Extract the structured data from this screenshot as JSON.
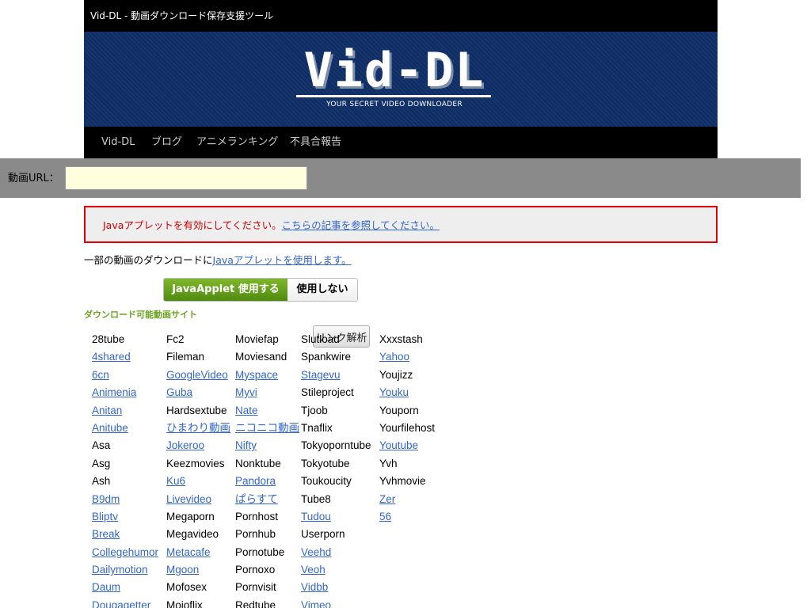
{
  "header": {
    "site_title": "Vid-DL - 動画ダウンロード保存支援ツール",
    "logo_text": "Vid-DL",
    "tagline": "YOUR SECRET VIDEO DOWNLOADER"
  },
  "nav": {
    "items": [
      {
        "label": "Vid-DL"
      },
      {
        "label": "ブログ"
      },
      {
        "label": "アニメランキング"
      },
      {
        "label": "不具合報告"
      }
    ]
  },
  "url_bar": {
    "label": "動画URL：",
    "value": "",
    "button_label": "リンク解析"
  },
  "warning": {
    "text": "Javaアプレットを有効にしてください。",
    "link_text": "こちらの記事を参照してください。"
  },
  "note": {
    "text": "一部の動画のダウンロードに",
    "link_text": "Javaアプレットを使用します。"
  },
  "toggle": {
    "on_label": "JavaApplet 使用する",
    "off_label": "使用しない"
  },
  "sites_heading": "ダウンロード可能動画サイト",
  "sites_columns": [
    [
      {
        "name": "28tube",
        "link": false
      },
      {
        "name": "4shared",
        "link": true
      },
      {
        "name": "6cn",
        "link": true
      },
      {
        "name": "Animenia",
        "link": true
      },
      {
        "name": "Anitan",
        "link": true
      },
      {
        "name": "Anitube",
        "link": true
      },
      {
        "name": "Asa",
        "link": false
      },
      {
        "name": "Asg",
        "link": false
      },
      {
        "name": "Ash",
        "link": false
      },
      {
        "name": "B9dm",
        "link": true
      },
      {
        "name": "Bliptv",
        "link": true
      },
      {
        "name": "Break",
        "link": true
      },
      {
        "name": "Collegehumor",
        "link": true
      },
      {
        "name": "Dailymotion",
        "link": true
      },
      {
        "name": "Daum",
        "link": true
      },
      {
        "name": "Dougagetter",
        "link": true
      }
    ],
    [
      {
        "name": "Fc2",
        "link": false
      },
      {
        "name": "Fileman",
        "link": false
      },
      {
        "name": "GoogleVideo",
        "link": true
      },
      {
        "name": "Guba",
        "link": true
      },
      {
        "name": "Hardsextube",
        "link": false
      },
      {
        "name": "ひまわり動画",
        "link": true
      },
      {
        "name": "Jokeroo",
        "link": true
      },
      {
        "name": "Keezmovies",
        "link": false
      },
      {
        "name": "Ku6",
        "link": true
      },
      {
        "name": "Livevideo",
        "link": true
      },
      {
        "name": "Megaporn",
        "link": false
      },
      {
        "name": "Megavideo",
        "link": false
      },
      {
        "name": "Metacafe",
        "link": true
      },
      {
        "name": "Mgoon",
        "link": true
      },
      {
        "name": "Mofosex",
        "link": false
      },
      {
        "name": "Mojoflix",
        "link": false
      }
    ],
    [
      {
        "name": "Moviefap",
        "link": false
      },
      {
        "name": "Moviesand",
        "link": false
      },
      {
        "name": "Myspace",
        "link": true
      },
      {
        "name": "Myvi",
        "link": true
      },
      {
        "name": "Nate",
        "link": true
      },
      {
        "name": "ニコニコ動画",
        "link": true
      },
      {
        "name": "Nifty",
        "link": true
      },
      {
        "name": "Nonktube",
        "link": false
      },
      {
        "name": "Pandora",
        "link": true
      },
      {
        "name": "ぱらすて",
        "link": true
      },
      {
        "name": "Pornhost",
        "link": false
      },
      {
        "name": "Pornhub",
        "link": false
      },
      {
        "name": "Pornotube",
        "link": false
      },
      {
        "name": "Pornoxo",
        "link": false
      },
      {
        "name": "Pornvisit",
        "link": false
      },
      {
        "name": "Redtube",
        "link": false
      }
    ],
    [
      {
        "name": "Slutload",
        "link": false
      },
      {
        "name": "Spankwire",
        "link": false
      },
      {
        "name": "Stagevu",
        "link": true
      },
      {
        "name": "Stileproject",
        "link": false
      },
      {
        "name": "Tjoob",
        "link": false
      },
      {
        "name": "Tnaflix",
        "link": false
      },
      {
        "name": "Tokyoporntube",
        "link": false
      },
      {
        "name": "Tokyotube",
        "link": false
      },
      {
        "name": "Toukoucity",
        "link": false
      },
      {
        "name": "Tube8",
        "link": false
      },
      {
        "name": "Tudou",
        "link": true
      },
      {
        "name": "Userporn",
        "link": false
      },
      {
        "name": "Veehd",
        "link": true
      },
      {
        "name": "Veoh",
        "link": true
      },
      {
        "name": "Vidbb",
        "link": true
      },
      {
        "name": "Vimeo",
        "link": true
      }
    ],
    [
      {
        "name": "Xxxstash",
        "link": false
      },
      {
        "name": "Yahoo",
        "link": true
      },
      {
        "name": "Youjizz",
        "link": false
      },
      {
        "name": "Youku",
        "link": true
      },
      {
        "name": "Youporn",
        "link": false
      },
      {
        "name": "Yourfilehost",
        "link": false
      },
      {
        "name": "Youtube",
        "link": true
      },
      {
        "name": "Yvh",
        "link": false
      },
      {
        "name": "Yvhmovie",
        "link": false
      },
      {
        "name": "Zer",
        "link": true
      },
      {
        "name": "56",
        "link": true
      }
    ]
  ],
  "colors": {
    "link": "#3366cc",
    "warning_text": "#cc0000",
    "warning_border": "#e00000",
    "heading_green": "#6aa321",
    "banner_blue": "#0f2e66",
    "url_bar_gray": "#8a8a8a"
  }
}
